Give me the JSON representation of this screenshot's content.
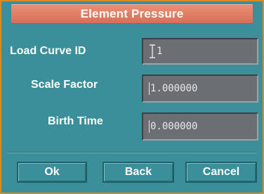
{
  "dialog": {
    "title": "Element Pressure",
    "fields": [
      {
        "label": "Load Curve ID",
        "value": "1"
      },
      {
        "label": "Scale Factor",
        "value": "1.000000"
      },
      {
        "label": "Birth Time",
        "value": "0.000000"
      }
    ],
    "buttons": {
      "ok": "Ok",
      "back": "Back",
      "cancel": "Cancel"
    }
  },
  "colors": {
    "background": "#3a8f9b",
    "titlebar": "#e07e66",
    "border": "#d88a1e",
    "field": "#6b6f74"
  },
  "icons": {
    "text_cursor": "i-beam-cursor-icon"
  }
}
